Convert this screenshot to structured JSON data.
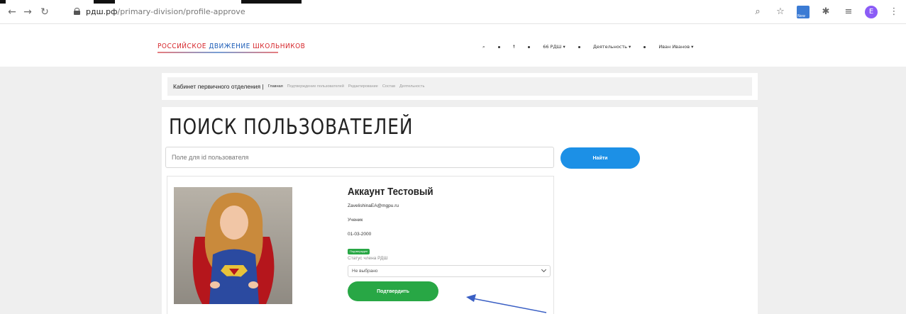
{
  "browser": {
    "url_domain": "рдш.рф",
    "url_path": "/primary-division/profile-approve",
    "avatar_letter": "E"
  },
  "header": {
    "logo_word1": "РОССИЙСКОЕ",
    "logo_word2": "ДВИЖЕНИЕ",
    "logo_word3": "ШКОЛЬНИКОВ",
    "nav_item_rdsh": "66 РДШ ▾",
    "nav_item_activity": "Деятельность ▾",
    "nav_item_user": "Иван Иванов ▾"
  },
  "breadcrumb": {
    "title": "Кабинет первичного отделения |",
    "links": [
      "Главная",
      "Подтверждение пользователей",
      "Редактирование",
      "Состав",
      "Деятельность"
    ]
  },
  "main": {
    "title": "ПОИСК ПОЛЬЗОВАТЕЛЕЙ",
    "search_placeholder": "Поле для id пользователя",
    "find_button": "Найти"
  },
  "user": {
    "name": "Аккаунт Тестовый",
    "email": "ZavelishinaEA@mgpu.ru",
    "role": "Ученик",
    "dob": "01-03-2000",
    "status_badge": "Подтвержден",
    "status_label": "Статус члена РДШ",
    "select_value": "Не выбрано",
    "confirm_button": "Подтвердить"
  },
  "colors": {
    "primary_blue": "#1c90e6",
    "success_green": "#28a745",
    "logo_red": "#d6262b",
    "logo_blue": "#1f5fb8",
    "annotation_arrow": "#3a5fc4"
  }
}
